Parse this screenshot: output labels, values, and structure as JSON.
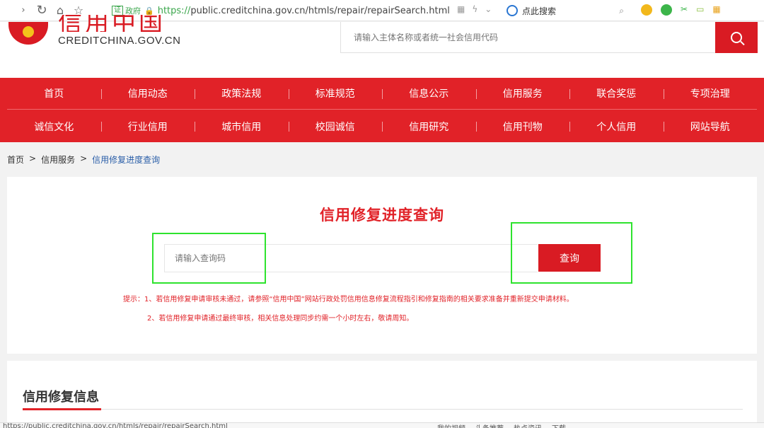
{
  "browser": {
    "gov_badge": "证",
    "gov_label": "政府",
    "url_scheme": "https://",
    "url_rest": "public.creditchina.gov.cn/htmls/repair/repairSearch.html",
    "search_placeholder": "点此搜索"
  },
  "header": {
    "logo_cn": "信用中国",
    "logo_en": "CREDITCHINA.GOV.CN",
    "search_placeholder": "请输入主体名称或者统一社会信用代码"
  },
  "nav": {
    "row1": [
      "首页",
      "信用动态",
      "政策法规",
      "标准规范",
      "信息公示",
      "信用服务",
      "联合奖惩",
      "专项治理"
    ],
    "row2": [
      "诚信文化",
      "行业信用",
      "城市信用",
      "校园诚信",
      "信用研究",
      "信用刊物",
      "个人信用",
      "网站导航"
    ]
  },
  "breadcrumb": {
    "home": "首页",
    "sep": ">",
    "section": "信用服务",
    "current": "信用修复进度查询"
  },
  "main": {
    "title": "信用修复进度查询",
    "query_placeholder": "请输入查询码",
    "query_button": "查询",
    "tip1": "提示：1、若信用修复申请审核未通过，请参照“信用中国”网站行政处罚信用信息修复流程指引和修复指南的相关要求准备并重新提交申请材料。",
    "tip2": "2、若信用修复申请通过最终审核，相关信息处理同步约需一个小时左右，敬请周知。"
  },
  "section2": {
    "title": "信用修复信息"
  },
  "status_bar": {
    "url": "https://public.creditchina.gov.cn/htmls/repair/repairSearch.html",
    "items": [
      "我的视频",
      "头条推荐",
      "热点资讯",
      "下载"
    ]
  },
  "colors": {
    "brand_red": "#e12228",
    "highlight_green": "#2ee32e",
    "link_blue": "#2b5fa8"
  }
}
